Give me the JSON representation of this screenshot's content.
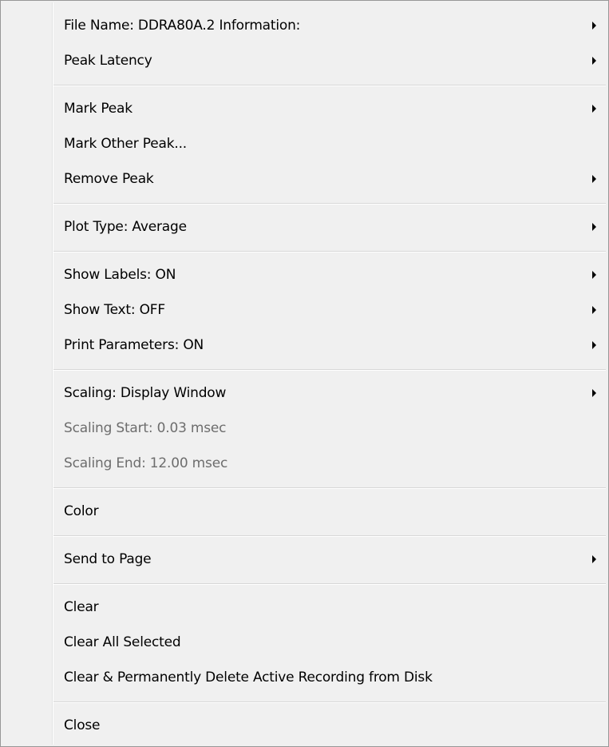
{
  "menu": {
    "items": [
      {
        "label": "File Name: DDRA80A.2  Information:",
        "submenu": true,
        "enabled": true
      },
      {
        "label": "Peak Latency",
        "submenu": true,
        "enabled": true
      },
      {
        "label": "Mark Peak",
        "submenu": true,
        "enabled": true
      },
      {
        "label": "Mark Other Peak...",
        "submenu": false,
        "enabled": true
      },
      {
        "label": "Remove Peak",
        "submenu": true,
        "enabled": true
      },
      {
        "label": "Plot Type: Average",
        "submenu": true,
        "enabled": true
      },
      {
        "label": "Show Labels: ON",
        "submenu": true,
        "enabled": true
      },
      {
        "label": "Show Text: OFF",
        "submenu": true,
        "enabled": true
      },
      {
        "label": "Print Parameters: ON",
        "submenu": true,
        "enabled": true
      },
      {
        "label": "Scaling: Display Window",
        "submenu": true,
        "enabled": true
      },
      {
        "label": "Scaling Start:  0.03 msec",
        "submenu": false,
        "enabled": false
      },
      {
        "label": "Scaling End: 12.00 msec",
        "submenu": false,
        "enabled": false
      },
      {
        "label": "Color",
        "submenu": false,
        "enabled": true
      },
      {
        "label": "Send to Page",
        "submenu": true,
        "enabled": true
      },
      {
        "label": "Clear",
        "submenu": false,
        "enabled": true
      },
      {
        "label": "Clear All Selected",
        "submenu": false,
        "enabled": true
      },
      {
        "label": "Clear & Permanently Delete Active Recording from Disk",
        "submenu": false,
        "enabled": true
      },
      {
        "label": "Close",
        "submenu": false,
        "enabled": true
      }
    ]
  },
  "colors": {
    "menu_background": "#f0f0f0",
    "menu_border": "#979797",
    "disabled_text": "#6d6d6d"
  }
}
